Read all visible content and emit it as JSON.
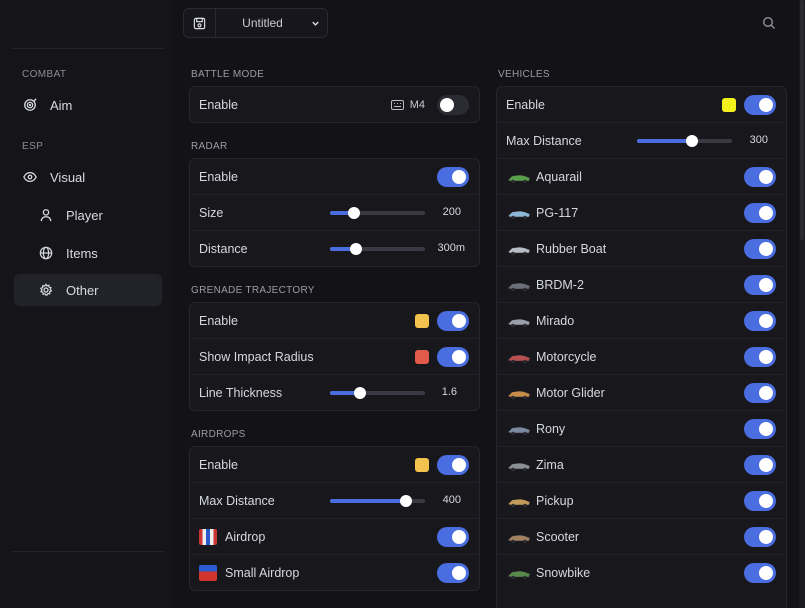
{
  "topbar": {
    "config_name": "Untitled"
  },
  "sidebar": {
    "sections": [
      {
        "label": "COMBAT",
        "items": [
          {
            "label": "Aim",
            "icon": "target-icon"
          }
        ]
      },
      {
        "label": "ESP",
        "items": [
          {
            "label": "Visual",
            "icon": "eye-icon"
          },
          {
            "label": "Player",
            "icon": "user-icon"
          },
          {
            "label": "Items",
            "icon": "globe-icon"
          },
          {
            "label": "Other",
            "icon": "gear-icon",
            "active": true
          }
        ]
      }
    ]
  },
  "battle_mode": {
    "title": "BATTLE MODE",
    "enable_label": "Enable",
    "hotkey": "M4",
    "enabled": false
  },
  "radar": {
    "title": "RADAR",
    "enable_label": "Enable",
    "enabled": true,
    "size_label": "Size",
    "size_value": "200",
    "size_fraction": 0.25,
    "distance_label": "Distance",
    "distance_value": "300m",
    "distance_fraction": 0.27
  },
  "grenade": {
    "title": "GRENADE TRAJECTORY",
    "enable_label": "Enable",
    "enabled": true,
    "enable_color": "#f2c14e",
    "impact_label": "Show Impact Radius",
    "impact_enabled": true,
    "impact_color": "#e25a4a",
    "thickness_label": "Line Thickness",
    "thickness_value": "1.6",
    "thickness_fraction": 0.32
  },
  "airdrops": {
    "title": "AIRDROPS",
    "enable_label": "Enable",
    "enabled": true,
    "enable_color": "#f2c14e",
    "max_distance_label": "Max Distance",
    "max_distance_value": "400",
    "max_distance_fraction": 0.8,
    "items": [
      {
        "label": "Airdrop",
        "enabled": true,
        "icon": "airdrop-crate-icon"
      },
      {
        "label": "Small Airdrop",
        "enabled": true,
        "icon": "small-airdrop-crate-icon"
      }
    ]
  },
  "vehicles": {
    "title": "VEHICLES",
    "enable_label": "Enable",
    "enabled": true,
    "enable_color": "#f3f01c",
    "max_distance_label": "Max Distance",
    "max_distance_value": "300",
    "max_distance_fraction": 0.58,
    "items": [
      {
        "label": "Aquarail",
        "enabled": true,
        "icon": "jetski-icon"
      },
      {
        "label": "PG-117",
        "enabled": true,
        "icon": "boat-icon"
      },
      {
        "label": "Rubber Boat",
        "enabled": true,
        "icon": "rubber-boat-icon"
      },
      {
        "label": "BRDM-2",
        "enabled": true,
        "icon": "armored-car-icon"
      },
      {
        "label": "Mirado",
        "enabled": true,
        "icon": "car-icon"
      },
      {
        "label": "Motorcycle",
        "enabled": true,
        "icon": "motorcycle-icon"
      },
      {
        "label": "Motor Glider",
        "enabled": true,
        "icon": "glider-icon"
      },
      {
        "label": "Rony",
        "enabled": true,
        "icon": "truck-icon"
      },
      {
        "label": "Zima",
        "enabled": true,
        "icon": "suv-icon"
      },
      {
        "label": "Pickup",
        "enabled": true,
        "icon": "pickup-icon"
      },
      {
        "label": "Scooter",
        "enabled": true,
        "icon": "scooter-icon"
      },
      {
        "label": "Snowbike",
        "enabled": true,
        "icon": "snowbike-icon"
      }
    ]
  }
}
